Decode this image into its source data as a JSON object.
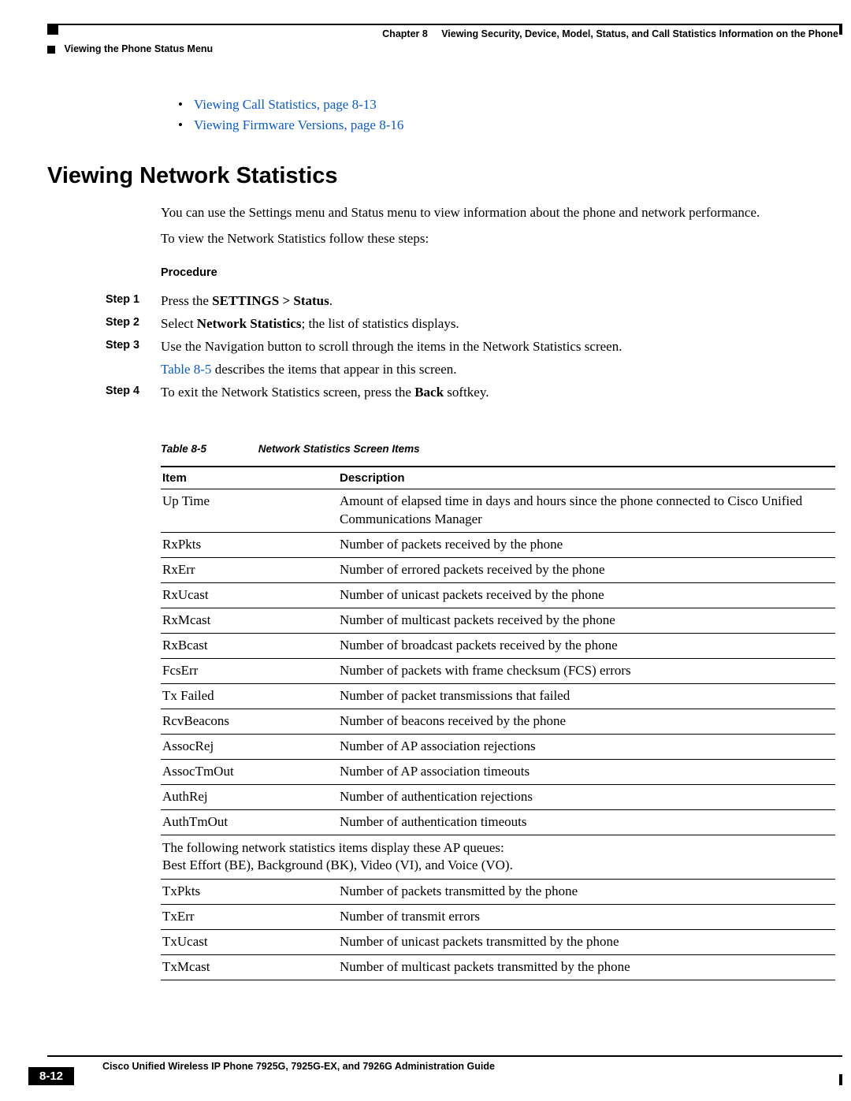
{
  "header": {
    "chapter_label": "Chapter 8",
    "chapter_title": "Viewing Security, Device, Model, Status, and Call Statistics Information on the Phone",
    "section": "Viewing the Phone Status Menu"
  },
  "bullets": [
    "Viewing Call Statistics, page 8-13",
    "Viewing Firmware Versions, page 8-16"
  ],
  "heading": "Viewing Network Statistics",
  "intro1": "You can use the Settings menu and Status menu to view information about the phone and network performance.",
  "intro2": "To view the Network Statistics follow these steps:",
  "procedure_label": "Procedure",
  "steps": [
    {
      "label": "Step 1",
      "prefix": "Press the ",
      "bold": "SETTINGS > Status",
      "suffix": "."
    },
    {
      "label": "Step 2",
      "prefix": "Select ",
      "bold": "Network Statistics",
      "suffix": "; the list of statistics displays."
    },
    {
      "label": "Step 3",
      "text": "Use the Navigation button to scroll through the items in the Network Statistics screen.",
      "sub_link": "Table 8-5",
      "sub_text": " describes the items that appear in this screen."
    },
    {
      "label": "Step 4",
      "prefix": "To exit the Network Statistics screen, press the ",
      "bold": "Back",
      "suffix": " softkey."
    }
  ],
  "table": {
    "label": "Table 8-5",
    "title": "Network Statistics Screen Items",
    "col1": "Item",
    "col2": "Description",
    "rows1": [
      {
        "item": "Up Time",
        "desc": "Amount of elapsed time in days and hours since the phone connected to Cisco Unified Communications Manager"
      },
      {
        "item": "RxPkts",
        "desc": "Number of packets received by the phone"
      },
      {
        "item": "RxErr",
        "desc": "Number of errored packets received by the phone"
      },
      {
        "item": "RxUcast",
        "desc": "Number of unicast packets received by the phone"
      },
      {
        "item": "RxMcast",
        "desc": "Number of multicast packets received by the phone"
      },
      {
        "item": "RxBcast",
        "desc": "Number of broadcast packets received by the phone"
      },
      {
        "item": "FcsErr",
        "desc": "Number of packets with frame checksum (FCS) errors"
      },
      {
        "item": "Tx Failed",
        "desc": "Number of packet transmissions that failed"
      },
      {
        "item": "RcvBeacons",
        "desc": "Number of beacons received by the phone"
      },
      {
        "item": "AssocRej",
        "desc": "Number of AP association rejections"
      },
      {
        "item": "AssocTmOut",
        "desc": "Number of AP association timeouts"
      },
      {
        "item": "AuthRej",
        "desc": "Number of authentication rejections"
      },
      {
        "item": "AuthTmOut",
        "desc": "Number of authentication timeouts"
      }
    ],
    "span_note_l1": "The following network statistics items display these AP queues:",
    "span_note_l2": "Best Effort (BE), Background (BK), Video (VI), and Voice (VO).",
    "rows2": [
      {
        "item": "TxPkts",
        "desc": "Number of packets transmitted by the phone"
      },
      {
        "item": "TxErr",
        "desc": "Number of transmit errors"
      },
      {
        "item": "TxUcast",
        "desc": "Number of unicast packets transmitted by the phone"
      },
      {
        "item": "TxMcast",
        "desc": "Number of multicast packets transmitted by the phone"
      }
    ]
  },
  "footer": {
    "guide": "Cisco Unified Wireless IP Phone 7925G, 7925G-EX, and 7926G Administration Guide",
    "page": "8-12"
  }
}
